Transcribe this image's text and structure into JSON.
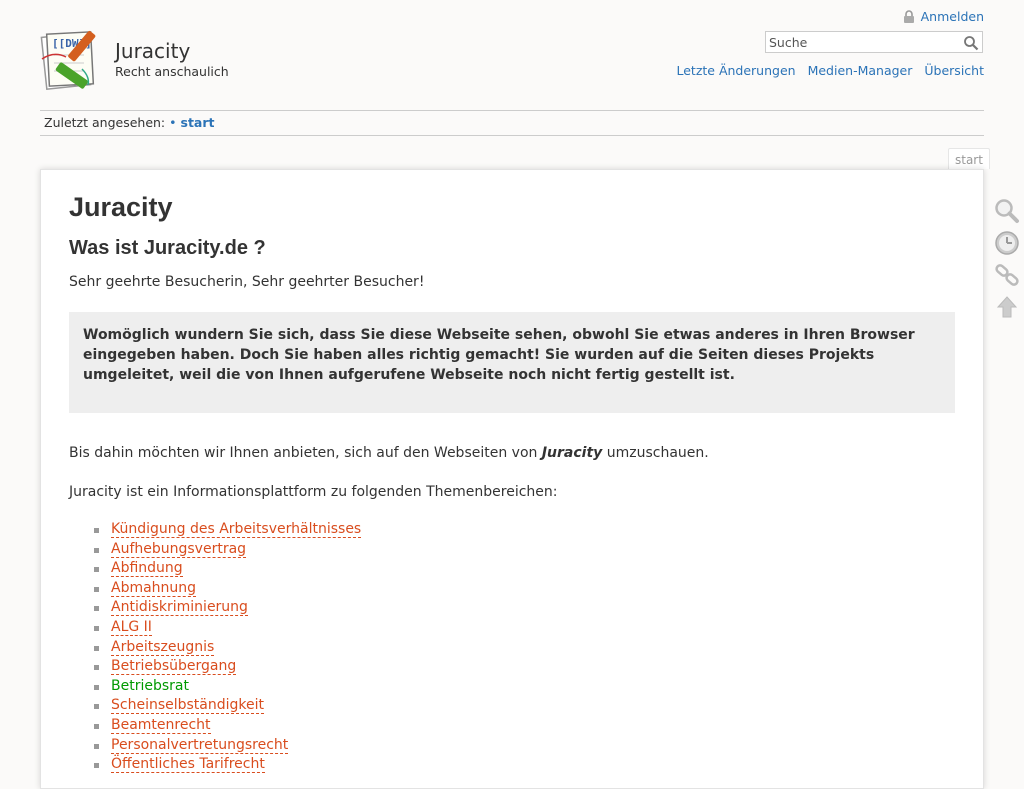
{
  "site": {
    "title": "Juracity",
    "tagline": "Recht anschaulich"
  },
  "user_tools": {
    "login": "Anmelden"
  },
  "search": {
    "placeholder": "Suche"
  },
  "site_tools": {
    "recent_changes": "Letzte Änderungen",
    "media_manager": "Medien-Manager",
    "sitemap": "Übersicht"
  },
  "breadcrumbs": {
    "label": "Zuletzt angesehen:",
    "separator": "•",
    "current": "start"
  },
  "page_id": "start",
  "content": {
    "h1": "Juracity",
    "h2": "Was ist Juracity.de ?",
    "greeting": "Sehr geehrte Besucherin, Sehr geehrter Besucher!",
    "notice": "Womöglich wundern Sie sich, dass Sie diese Webseite sehen, obwohl Sie etwas anderes in Ihren Browser eingegeben haben. Doch Sie haben alles richtig gemacht! Sie wurden auf die Seiten dieses Projekts umgeleitet, weil die von Ihnen aufgerufene Webseite noch nicht fertig gestellt ist.",
    "intro2_before": "Bis dahin möchten wir Ihnen anbieten, sich auf den Webseiten von ",
    "intro2_em": "Juracity",
    "intro2_after": " umzuschauen.",
    "intro3": "Juracity ist ein Informationsplattform zu folgenden Themenbereichen:",
    "topics": [
      "Kündigung des Arbeitsverhältnisses",
      "Aufhebungsvertrag",
      "Abfindung",
      "Abmahnung",
      "Antidiskriminierung",
      "ALG II",
      "Arbeitszeugnis",
      "Betriebsübergang",
      "Betriebsrat",
      "Scheinselbständigkeit",
      "Beamtenrecht",
      "Personalvertretungsrecht",
      "Öffentliches Tarifrecht"
    ]
  },
  "colors": {
    "link": "#2b73b7",
    "missing_link": "#d94d1e",
    "existing_link": "#009900",
    "notice_bg": "#eeeeee"
  },
  "icons": [
    "lock-icon",
    "search-icon",
    "magnifier-icon",
    "clock-icon",
    "chain-link-icon",
    "arrow-up-icon"
  ]
}
